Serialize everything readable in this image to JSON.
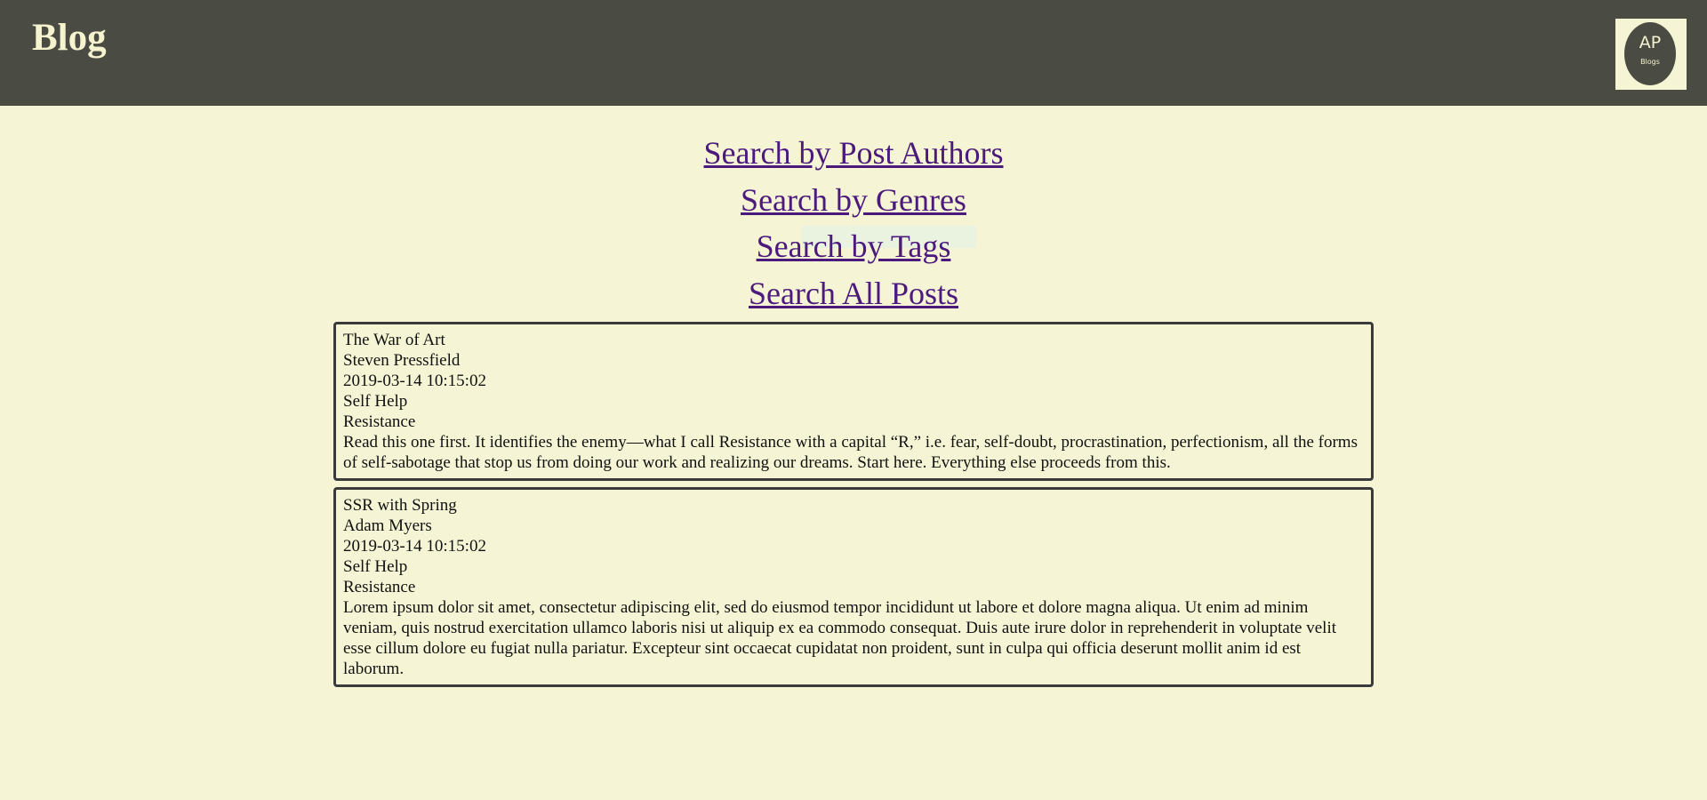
{
  "header": {
    "title": "Blog",
    "logo_main": "AP",
    "logo_sub": "Blogs"
  },
  "nav": {
    "links": [
      "Search by Post Authors",
      "Search by Genres",
      "Search by Tags",
      "Search All Posts"
    ]
  },
  "posts": [
    {
      "title": "The War of Art",
      "author": "Steven Pressfield",
      "date": "2019-03-14 10:15:02",
      "genre": "Self Help",
      "tag": "Resistance",
      "body": "Read this one first. It identifies the enemy—what I call Resistance with a capital “R,” i.e. fear, self-doubt, procrastination, perfectionism, all the forms of self-sabotage that stop us from doing our work and realizing our dreams. Start here. Everything else proceeds from this."
    },
    {
      "title": "SSR with Spring",
      "author": "Adam Myers",
      "date": "2019-03-14 10:15:02",
      "genre": "Self Help",
      "tag": "Resistance",
      "body": "Lorem ipsum dolor sit amet, consectetur adipiscing elit, sed do eiusmod tempor incididunt ut labore et dolore magna aliqua. Ut enim ad minim veniam, quis nostrud exercitation ullamco laboris nisi ut aliquip ex ea commodo consequat. Duis aute irure dolor in reprehenderit in voluptate velit esse cillum dolore eu fugiat nulla pariatur. Excepteur sint occaecat cupidatat non proident, sunt in culpa qui officia deserunt mollit anim id est laborum."
    }
  ],
  "colors": {
    "header_bg": "#4a4b43",
    "page_bg": "#f5f5d5",
    "link": "#4b1a7c",
    "brand_text": "#f6f3cf"
  }
}
